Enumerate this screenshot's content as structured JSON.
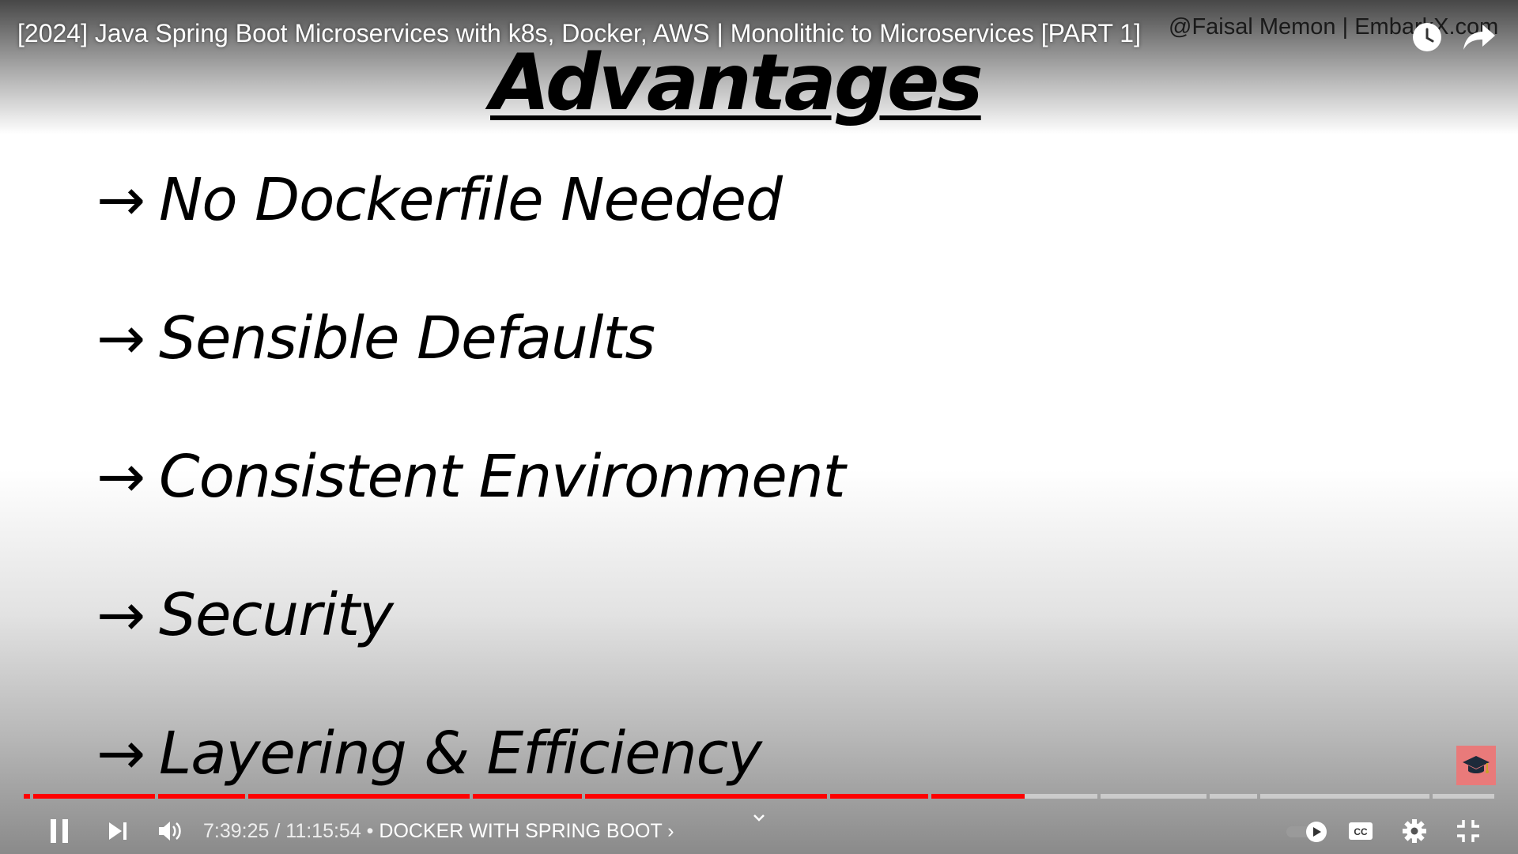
{
  "video": {
    "title": "[2024] Java Spring Boot Microservices with k8s, Docker, AWS | Monolithic to Microservices [PART 1]",
    "watermark": "@Faisal Memon | EmbarkX.com"
  },
  "slide": {
    "title": "Advantages",
    "bullets": [
      {
        "arrow": "→",
        "text": "No Dockerfile Needed"
      },
      {
        "arrow": "→",
        "text": "Sensible Defaults"
      },
      {
        "arrow": "→",
        "text": "Consistent Environment"
      },
      {
        "arrow": "→",
        "text": "Security"
      },
      {
        "arrow": "→",
        "text": "Layering & Efficiency"
      }
    ]
  },
  "player": {
    "current_time": "7:39:25",
    "separator": " / ",
    "duration": "11:15:54",
    "chapter_separator": " • ",
    "chapter": "DOCKER WITH SPRING BOOT",
    "chapter_chevron": "›",
    "progress_fraction": 0.653,
    "colors": {
      "accent": "#ff0000",
      "badge": "#e97a7a"
    }
  },
  "icons": {
    "top_right": [
      "watch-later-icon",
      "share-icon"
    ],
    "controls_left": [
      "pause-icon",
      "next-icon",
      "volume-icon"
    ],
    "controls_right": [
      "autoplay-toggle-icon",
      "captions-icon",
      "settings-icon",
      "exit-fullscreen-icon"
    ],
    "badge": "graduation-cap-icon"
  }
}
